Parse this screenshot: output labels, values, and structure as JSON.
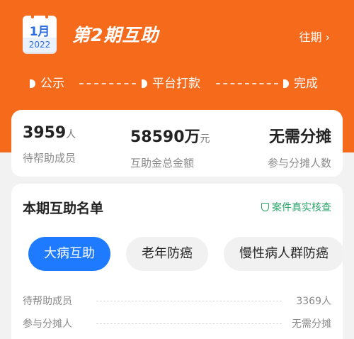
{
  "header": {
    "calendar_month": "1月",
    "calendar_year": "2022",
    "title": "第2期互助",
    "past_link": "往期 ›"
  },
  "progress_steps": [
    {
      "label": "公示"
    },
    {
      "label": "平台打款"
    },
    {
      "label": "完成"
    }
  ],
  "summary": {
    "members": {
      "value": "3959",
      "unit": "人",
      "label": "待帮助成员"
    },
    "total": {
      "value": "58590万",
      "unit": "元",
      "label": "互助金总金额"
    },
    "share": {
      "value": "无需分摊",
      "unit": "",
      "label": "参与分摊人数"
    }
  },
  "list_section": {
    "title": "本期互助名单",
    "verify_link": "案件真实核查",
    "tabs": [
      {
        "label": "大病互助",
        "active": true
      },
      {
        "label": "老年防癌",
        "active": false
      },
      {
        "label": "慢性病人群防癌",
        "active": false
      }
    ],
    "rows": [
      {
        "key": "待帮助成员",
        "value": "3369人"
      },
      {
        "key": "参与分摊人",
        "value": "无需分摊"
      }
    ]
  },
  "colors": {
    "brand_orange": "#f66a1c",
    "active_tab_blue": "#1e7bff",
    "verify_green": "#2aa56a"
  }
}
